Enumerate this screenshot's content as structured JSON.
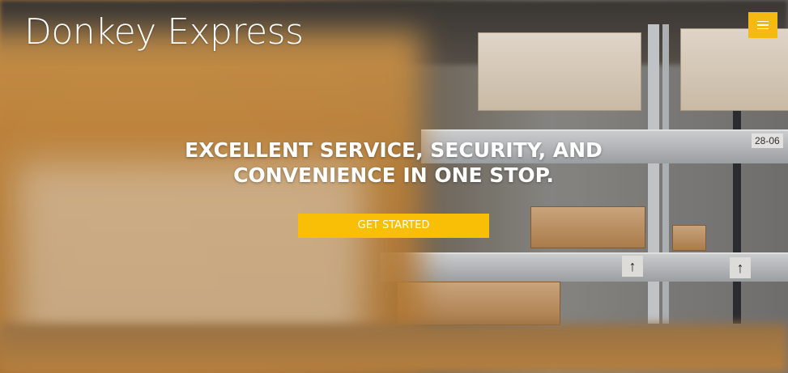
{
  "brand": {
    "name": "Donkey Express"
  },
  "nav": {
    "menu_icon": "hamburger-menu-icon",
    "accent_color": "#f5b914"
  },
  "hero": {
    "headline_line1": "EXCELLENT SERVICE, SECURITY, AND",
    "headline_line2": "CONVENIENCE IN ONE STOP.",
    "cta_label": "GET STARTED",
    "cta_color": "#f9bf07"
  },
  "background": {
    "shelf_tag": "28-06"
  }
}
